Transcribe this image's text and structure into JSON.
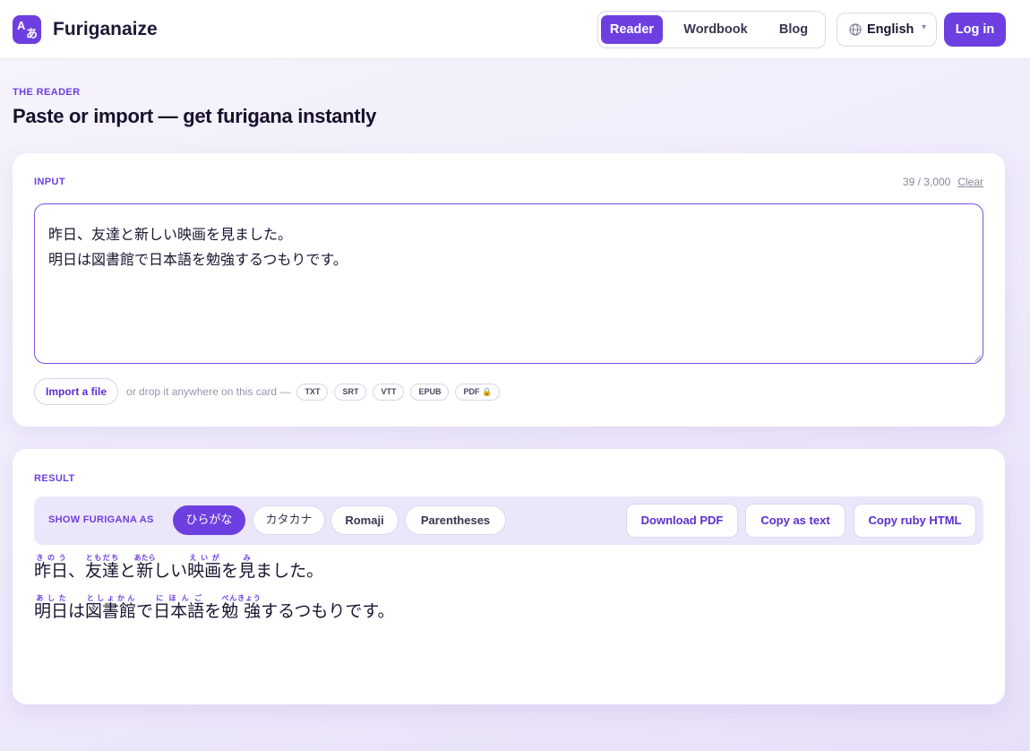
{
  "header": {
    "logo_latin": "A",
    "logo_kana": "あ",
    "app_name": "Furiganaize",
    "nav": [
      {
        "label": "Reader",
        "active": true
      },
      {
        "label": "Wordbook",
        "active": false
      },
      {
        "label": "Blog",
        "active": false
      }
    ],
    "language": "English",
    "login_label": "Log in"
  },
  "page": {
    "kicker": "THE READER",
    "title": "Paste or import — get furigana instantly"
  },
  "input_card": {
    "label": "INPUT",
    "char_count": "39",
    "char_limit": "3,000",
    "clear_label": "Clear",
    "text": "昨日、友達と新しい映画を見ました。\n明日は図書館で日本語を勉強するつもりです。",
    "import_label": "Import a file",
    "drop_hint": "or drop it anywhere on this card —",
    "formats": [
      "TXT",
      "SRT",
      "VTT",
      "EPUB",
      "PDF 🔒"
    ]
  },
  "result_card": {
    "label": "RESULT",
    "show_as_label": "SHOW FURIGANA AS",
    "modes": [
      {
        "label": "ひらがな",
        "active": true
      },
      {
        "label": "カタカナ",
        "active": false
      },
      {
        "label": "Romaji",
        "active": false
      },
      {
        "label": "Parentheses",
        "active": false
      }
    ],
    "actions": [
      "Download PDF",
      "Copy as text",
      "Copy ruby HTML"
    ],
    "lines": [
      [
        {
          "base": "昨日",
          "ruby": "きのう"
        },
        {
          "base": "、"
        },
        {
          "base": "友達",
          "ruby": "ともだち"
        },
        {
          "base": "と"
        },
        {
          "base": "新",
          "ruby": "あたら"
        },
        {
          "base": "しい"
        },
        {
          "base": "映画",
          "ruby": "えいが"
        },
        {
          "base": "を"
        },
        {
          "base": "見",
          "ruby": "み"
        },
        {
          "base": "ました。"
        }
      ],
      [
        {
          "base": "明日",
          "ruby": "あした"
        },
        {
          "base": "は"
        },
        {
          "base": "図書館",
          "ruby": "としょかん"
        },
        {
          "base": "で"
        },
        {
          "base": "日本語",
          "ruby": "にほんご"
        },
        {
          "base": "を"
        },
        {
          "base": "勉 強",
          "ruby": "べんきょう"
        },
        {
          "base": "するつもりです。"
        }
      ]
    ]
  },
  "colors": {
    "accent": "#6d3fe0",
    "accent_soft": "#ece6fb"
  }
}
